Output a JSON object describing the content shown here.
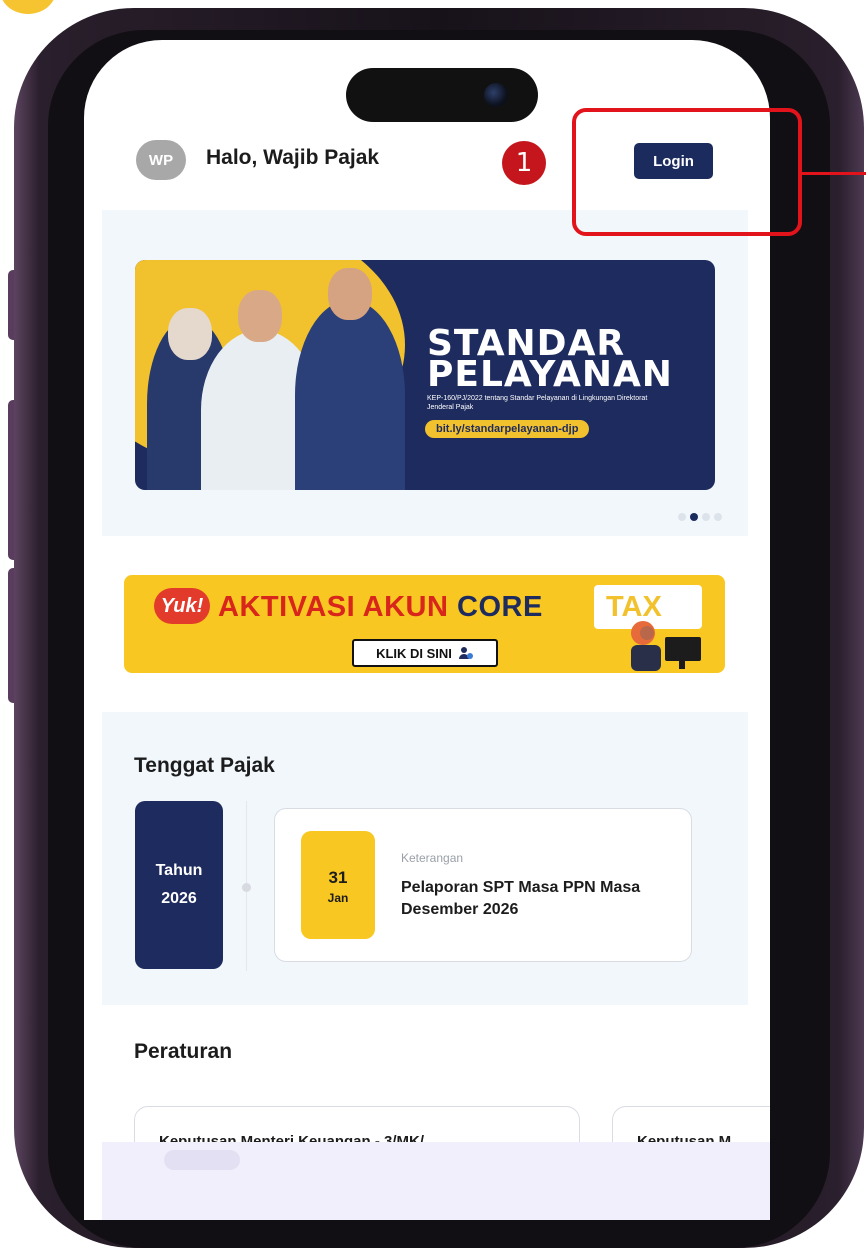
{
  "header": {
    "avatar_initials": "WP",
    "greeting": "Halo, Wajib Pajak",
    "login_label": "Login"
  },
  "banner": {
    "title": "STANDAR\nPELAYANAN",
    "subtitle": "KEP-160/PJ/2022 tentang Standar Pelayanan di Lingkungan Direktorat Jenderal Pajak",
    "link_text": "bit.ly/standarpelayanan-djp",
    "carousel_count": 4,
    "carousel_active_index": 1
  },
  "coretax_banner": {
    "yuk": "Yuk!",
    "headline": "AKTIVASI AKUN",
    "brand_core": "CORE",
    "brand_tax": "TAX",
    "cta_label": "KLIK DI SINI"
  },
  "tenggat": {
    "title": "Tenggat Pajak",
    "year_label": "Tahun",
    "year_value": "2026",
    "day": "31",
    "month": "Jan",
    "keterangan_label": "Keterangan",
    "keterangan_text": "Pelaporan SPT Masa PPN Masa Desember 2026"
  },
  "peraturan": {
    "title": "Peraturan",
    "cards": [
      {
        "text": "Keputusan Menteri Keuangan - 3/MK/"
      },
      {
        "text": "Keputusan M"
      }
    ]
  },
  "annotation": {
    "step_number": "1",
    "color": "#e3131b"
  },
  "colors": {
    "navy": "#1e2b5e",
    "yellow": "#f9c721",
    "red": "#d9261c"
  }
}
